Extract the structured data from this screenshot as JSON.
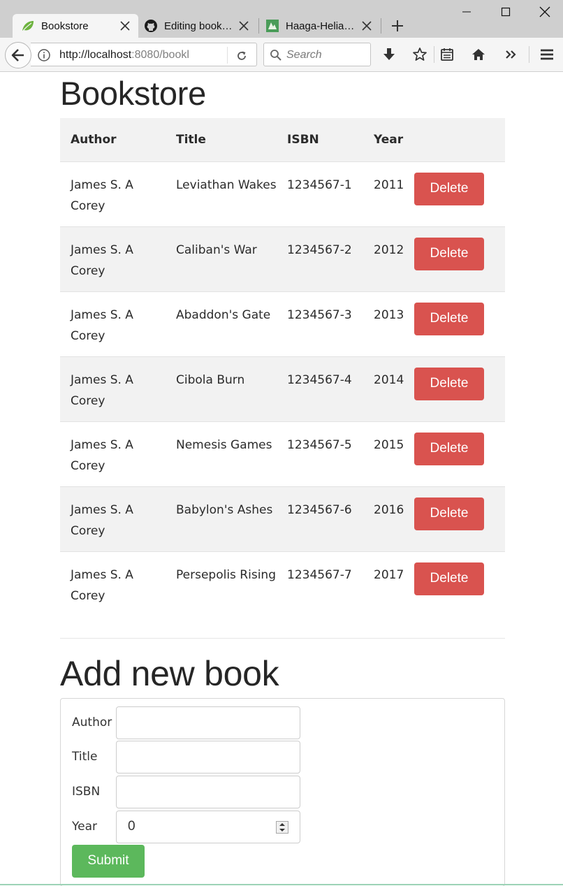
{
  "browser": {
    "tabs": [
      {
        "label": "Bookstore",
        "icon": "spring-leaf-icon"
      },
      {
        "label": "Editing book…",
        "icon": "github-icon"
      },
      {
        "label": "Haaga-Helia…",
        "icon": "haaga-helia-icon"
      }
    ],
    "url_host": "http://localhost",
    "url_rest": ":8080/bookl",
    "search_placeholder": "Search"
  },
  "page": {
    "title": "Bookstore",
    "table": {
      "headers": [
        "Author",
        "Title",
        "ISBN",
        "Year"
      ],
      "rows": [
        {
          "author": "James S. A Corey",
          "title": "Leviathan Wakes",
          "isbn": "1234567-1",
          "year": "2011",
          "action": "Delete"
        },
        {
          "author": "James S. A Corey",
          "title": "Caliban's War",
          "isbn": "1234567-2",
          "year": "2012",
          "action": "Delete"
        },
        {
          "author": "James S. A Corey",
          "title": "Abaddon's Gate",
          "isbn": "1234567-3",
          "year": "2013",
          "action": "Delete"
        },
        {
          "author": "James S. A Corey",
          "title": "Cibola Burn",
          "isbn": "1234567-4",
          "year": "2014",
          "action": "Delete"
        },
        {
          "author": "James S. A Corey",
          "title": "Nemesis Games",
          "isbn": "1234567-5",
          "year": "2015",
          "action": "Delete"
        },
        {
          "author": "James S. A Corey",
          "title": "Babylon's Ashes",
          "isbn": "1234567-6",
          "year": "2016",
          "action": "Delete"
        },
        {
          "author": "James S. A Corey",
          "title": "Persepolis Rising",
          "isbn": "1234567-7",
          "year": "2017",
          "action": "Delete"
        }
      ]
    },
    "add_form": {
      "heading": "Add new book",
      "author_label": "Author",
      "title_label": "Title",
      "isbn_label": "ISBN",
      "year_label": "Year",
      "author_value": "",
      "title_value": "",
      "isbn_value": "",
      "year_value": "0",
      "submit_label": "Submit"
    }
  },
  "colors": {
    "delete": "#d9534f",
    "submit": "#5cb85c",
    "stripe": "#f2f2f2"
  }
}
